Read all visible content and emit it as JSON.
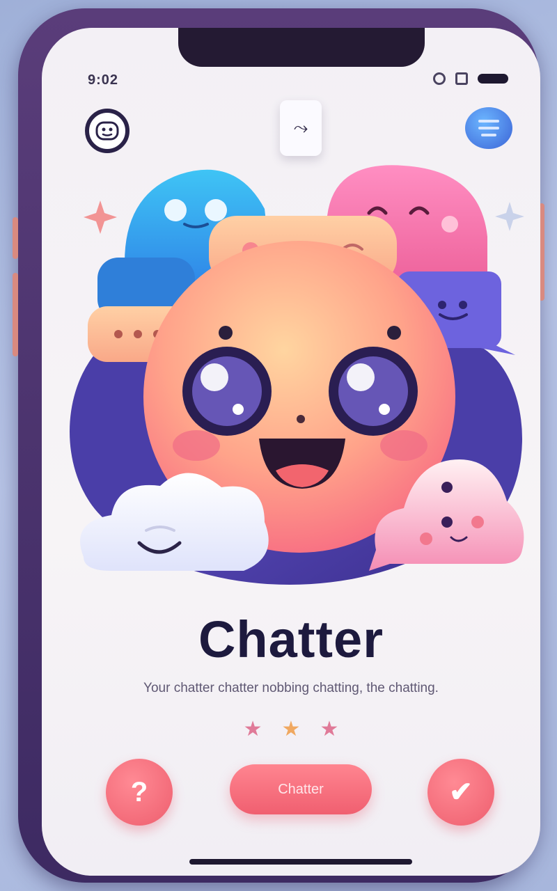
{
  "status_bar": {
    "time": "9:02"
  },
  "header": {
    "center_glyph": "⤳"
  },
  "main": {
    "title": "Chatter",
    "subtitle": "Your chatter chatter nobbing chatting, the chatting.",
    "rating_stars": [
      "★",
      "★",
      "★"
    ],
    "star_colors": [
      "#e07a98",
      "#f0a860",
      "#e07a98"
    ],
    "actions": {
      "left_label": "?",
      "primary_label": "Chatter",
      "right_label": "✔"
    }
  },
  "colors": {
    "accent": "#f06b7a",
    "title": "#1d1a3e",
    "blue_bubble": "#3aa9f0",
    "pink_bubble": "#f27ab6",
    "purple_back": "#4b3f9e"
  }
}
